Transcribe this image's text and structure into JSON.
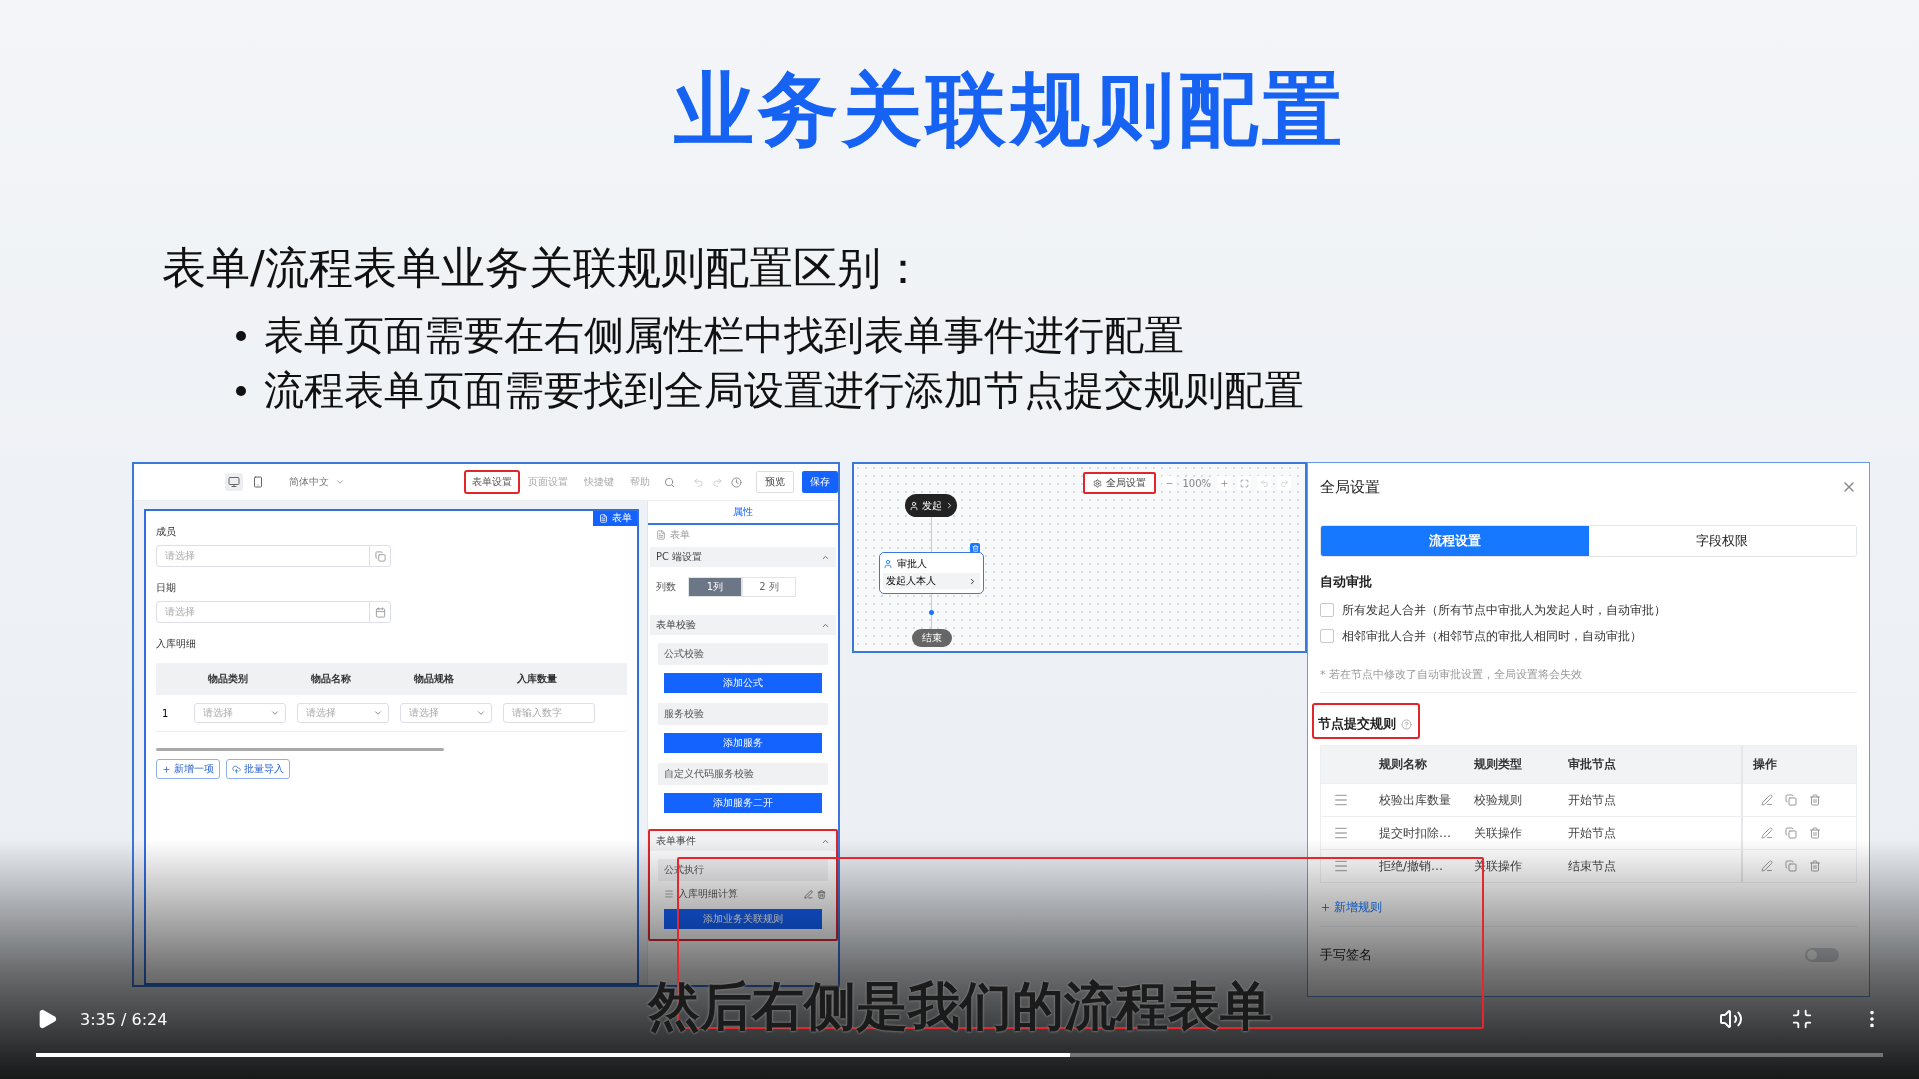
{
  "slide": {
    "title": "业务关联规则配置",
    "heading": "表单/流程表单业务关联规则配置区别：",
    "bullets": [
      "表单页面需要在右侧属性栏中找到表单事件进行配置",
      "流程表单页面需要找到全局设置进行添加节点提交规则配置"
    ]
  },
  "form_editor": {
    "toolbar": {
      "devices": [
        {
          "kind": "desktop",
          "selected": true
        },
        {
          "kind": "mobile",
          "selected": false
        }
      ],
      "language": "简体中文",
      "tabs": [
        {
          "label": "表单设置",
          "highlighted": true
        },
        {
          "label": "页面设置",
          "highlighted": false
        },
        {
          "label": "快捷键",
          "highlighted": false
        },
        {
          "label": "帮助",
          "highlighted": false
        }
      ],
      "preview_button": "预览",
      "save_button": "保存"
    },
    "canvas": {
      "badge": "表单",
      "fields": [
        {
          "label": "成员",
          "placeholder": "请选择",
          "kind": "member"
        },
        {
          "label": "日期",
          "placeholder": "请选择",
          "kind": "date"
        }
      ],
      "subtable": {
        "label": "入库明细",
        "columns": [
          "物品类别",
          "物品名称",
          "物品规格",
          "入库数量"
        ],
        "rows": [
          {
            "index": "1",
            "cells": [
              {
                "kind": "select",
                "placeholder": "请选择"
              },
              {
                "kind": "select",
                "placeholder": "请选择"
              },
              {
                "kind": "select",
                "placeholder": "请选择"
              },
              {
                "kind": "number",
                "placeholder": "请输入数字"
              }
            ]
          }
        ],
        "actions": [
          {
            "kind": "add",
            "label": "新增一项"
          },
          {
            "kind": "import",
            "label": "批量导入"
          }
        ]
      }
    },
    "properties": {
      "tab": "属性",
      "component": "表单",
      "sections": [
        {
          "title": "PC 端设置",
          "highlighted": false,
          "kind": "columns",
          "label": "列数",
          "options": [
            {
              "label": "1列",
              "selected": true
            },
            {
              "label": "2 列",
              "selected": false
            }
          ]
        },
        {
          "title": "表单校验",
          "highlighted": false,
          "kind": "groups",
          "groups": [
            {
              "title": "公式校验",
              "button": "添加公式"
            },
            {
              "title": "服务校验",
              "button": "添加服务"
            },
            {
              "title": "自定义代码服务校验",
              "button": "添加服务二开"
            }
          ]
        },
        {
          "title": "表单事件",
          "highlighted": true,
          "kind": "groups",
          "groups": [
            {
              "title": "公式执行",
              "items": [
                "入库明细计算"
              ],
              "button": "添加业务关联规则"
            }
          ]
        }
      ]
    }
  },
  "flow_designer": {
    "toolbar": {
      "settings_button": {
        "label": "全局设置",
        "highlighted": true
      },
      "zoom": "100%"
    },
    "nodes": [
      {
        "kind": "start",
        "label": "发起"
      },
      {
        "kind": "approver",
        "label": "审批人",
        "detail": "发起人本人"
      },
      {
        "kind": "end",
        "label": "结束"
      }
    ]
  },
  "global_settings": {
    "title": "全局设置",
    "tabs": [
      {
        "label": "流程设置",
        "selected": true
      },
      {
        "label": "字段权限",
        "selected": false
      }
    ],
    "auto_approval": {
      "title": "自动审批",
      "options": [
        {
          "label": "所有发起人合并（所有节点中审批人为发起人时，自动审批）",
          "checked": false
        },
        {
          "label": "相邻审批人合并（相邻节点的审批人相同时，自动审批）",
          "checked": false
        }
      ],
      "note": "* 若在节点中修改了自动审批设置，全局设置将会失效"
    },
    "node_rules": {
      "title": "节点提交规则",
      "highlighted": true,
      "columns": [
        "规则名称",
        "规则类型",
        "审批节点",
        "操作"
      ],
      "rows": [
        {
          "name": "校验出库数量",
          "type": "校验规则",
          "node": "开始节点"
        },
        {
          "name": "提交时扣除…",
          "type": "关联操作",
          "node": "开始节点"
        },
        {
          "name": "拒绝/撤销…",
          "type": "关联操作",
          "node": "结束节点"
        }
      ],
      "add_link": "新增规则"
    },
    "signature": {
      "label": "手写签名",
      "on": false
    }
  },
  "player": {
    "playing": false,
    "time": "3:35 / 6:24",
    "subtitle": "然后右侧是我们的流程表单",
    "progress": {
      "level": 0.56
    }
  }
}
